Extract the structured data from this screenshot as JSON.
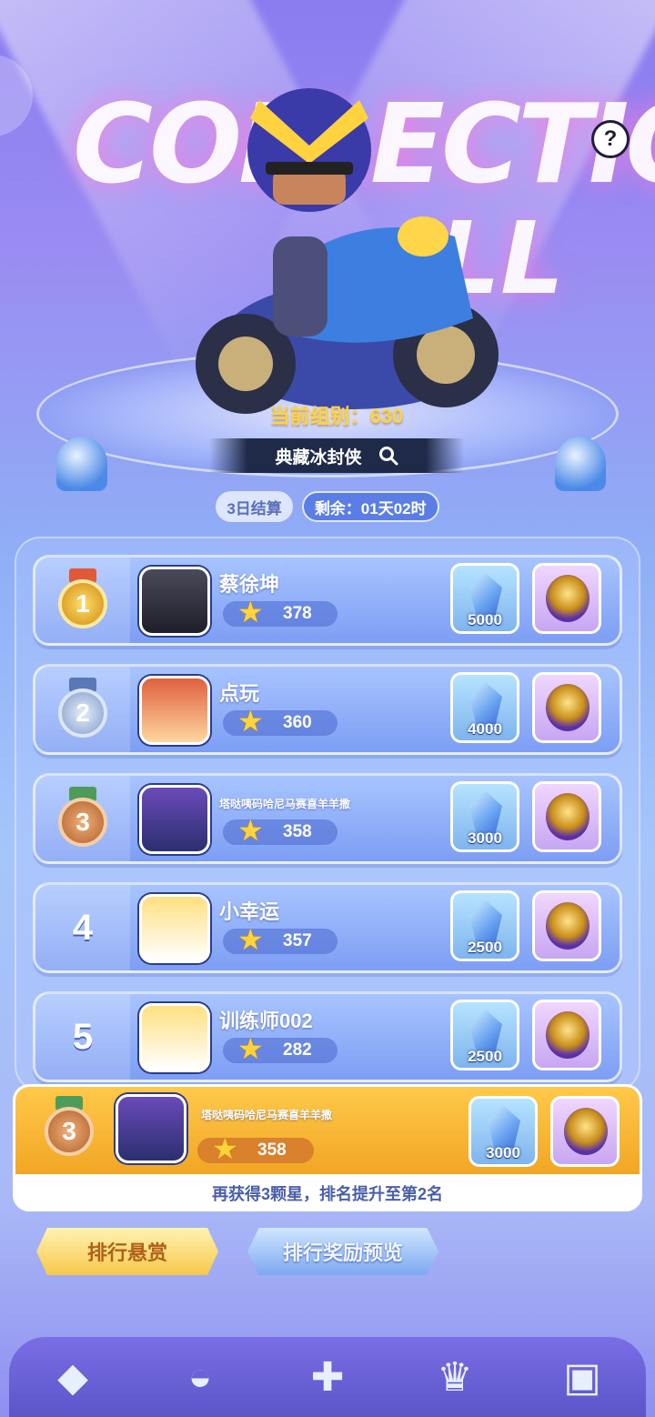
{
  "header": {
    "bg_word_1": "COLLECTION",
    "bg_word_2": "LL",
    "group_label": "当前组别：630",
    "collection_name": "典藏冰封侠"
  },
  "settle": {
    "period": "3日结算",
    "remaining": "剩余：01天02时"
  },
  "rankings": [
    {
      "rank": "1",
      "name": "蔡徐坤",
      "stars": "378",
      "crystal": "5000"
    },
    {
      "rank": "2",
      "name": "点玩",
      "stars": "360",
      "crystal": "4000"
    },
    {
      "rank": "3",
      "name": "塔哒咦码哈尼马赛喜羊羊撒",
      "stars": "358",
      "crystal": "3000"
    },
    {
      "rank": "4",
      "name": "小幸运",
      "stars": "357",
      "crystal": "2500"
    },
    {
      "rank": "5",
      "name": "训练师002",
      "stars": "282",
      "crystal": "2500"
    }
  ],
  "me": {
    "rank": "3",
    "name": "塔哒咦码哈尼马赛喜羊羊撒",
    "stars": "358",
    "crystal": "3000",
    "hint": "再获得3颗星，排名提升至第2名"
  },
  "buttons": {
    "reward_bounty": "排行悬赏",
    "reward_preview": "排行奖励预览"
  },
  "colors": {
    "gold": "#f2a624",
    "accent_blue": "#5a7de6",
    "medal_gold": "#e0a020",
    "medal_silver": "#7f9cc8",
    "medal_bronze": "#c0733a"
  }
}
